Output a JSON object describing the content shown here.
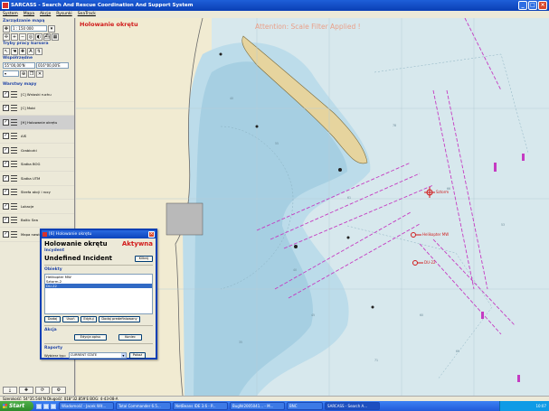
{
  "window": {
    "title": "SARCASS - Search And Rescue Coordination And Support System",
    "buttons": [
      "_",
      "□",
      "×"
    ]
  },
  "menu": [
    "System",
    "Mapa",
    "Akcje",
    "Rysunki",
    "SeaTrack"
  ],
  "left": {
    "map_mgmt_title": "Zarządzanie mapą",
    "scale_value": "1 : 150 000",
    "modes_title": "Tryby pracy kursora",
    "coords_title": "Współrzędne",
    "lat_value": "55°00,00'N",
    "lon_value": "016°00,00'E",
    "layers_title": "Warstwy mapy",
    "layers": [
      {
        "label": "[C] Wnioski ruchu"
      },
      {
        "label": "[C] Mobi"
      },
      {
        "label": "[H] Holowanie okrętu",
        "selected": true
      },
      {
        "label": "AIS"
      },
      {
        "label": "Grabiczki"
      },
      {
        "label": "Siatka BOG"
      },
      {
        "label": "Siatka UTM"
      },
      {
        "label": "Strefa akcji i rocy"
      },
      {
        "label": "Lokacje"
      },
      {
        "label": "Baltic Sea"
      },
      {
        "label": "Mapa nawigacyjna"
      }
    ]
  },
  "map": {
    "title_label": "Holowanie okrętu",
    "banner": "Attention: Scale Filter Applied !",
    "markers": [
      {
        "label": "Sztorm"
      },
      {
        "label": "Helikopter MW"
      },
      {
        "label": "DU-22"
      }
    ],
    "colors": {
      "land": "#f1ebd2",
      "shallow": "#b6d9e8",
      "deep": "#cfe3ea",
      "track": "#c53bc2",
      "marker": "#d01a1a"
    }
  },
  "dialog": {
    "title": "[6] Holowanie okrętu",
    "heading": "Holowanie okrętu",
    "active": "Aktywna",
    "incident_section": "Incydent",
    "incident_name": "Undefined Incident",
    "select_button": "Kilknij",
    "objects_section": "Obiekty",
    "objects": [
      "Helikopter MW",
      "Sztorm-2",
      "DU-22"
    ],
    "selected_object": 2,
    "obj_buttons": [
      "Dodaj",
      "Usuń",
      "Edytuj",
      "Dodaj predefiniowany"
    ],
    "action_section": "Akcja",
    "action_buttons": [
      "Edycja opisu",
      "Koniec"
    ],
    "reports_section": "Raporty",
    "reports_label": "Wybierz typ:",
    "reports_value": "CURRENT STATE",
    "reports_button": "Pokaż"
  },
  "status": {
    "text": "Szerokość: 54°35.544'N Długość: 018°32.859'E BOG: 4-43-08-A"
  },
  "taskbar": {
    "start": "Start",
    "tasks": [
      "Wiadomość - Jacek Wit...",
      "Total Commander 6.5...",
      "NetBeans IDE 3.6 - P...",
      "BugNr2005041... - M...",
      "BNC",
      "SARCASS - Search A..."
    ],
    "clock": "10:07"
  }
}
